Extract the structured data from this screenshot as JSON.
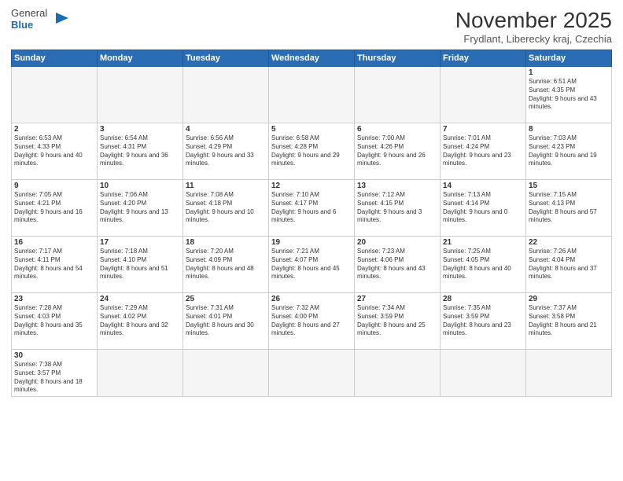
{
  "logo": {
    "general": "General",
    "blue": "Blue"
  },
  "title": {
    "month_year": "November 2025",
    "location": "Frydlant, Liberecky kraj, Czechia"
  },
  "weekdays": [
    "Sunday",
    "Monday",
    "Tuesday",
    "Wednesday",
    "Thursday",
    "Friday",
    "Saturday"
  ],
  "weeks": [
    [
      {
        "day": "",
        "info": ""
      },
      {
        "day": "",
        "info": ""
      },
      {
        "day": "",
        "info": ""
      },
      {
        "day": "",
        "info": ""
      },
      {
        "day": "",
        "info": ""
      },
      {
        "day": "",
        "info": ""
      },
      {
        "day": "1",
        "info": "Sunrise: 6:51 AM\nSunset: 4:35 PM\nDaylight: 9 hours and 43 minutes."
      }
    ],
    [
      {
        "day": "2",
        "info": "Sunrise: 6:53 AM\nSunset: 4:33 PM\nDaylight: 9 hours and 40 minutes."
      },
      {
        "day": "3",
        "info": "Sunrise: 6:54 AM\nSunset: 4:31 PM\nDaylight: 9 hours and 36 minutes."
      },
      {
        "day": "4",
        "info": "Sunrise: 6:56 AM\nSunset: 4:29 PM\nDaylight: 9 hours and 33 minutes."
      },
      {
        "day": "5",
        "info": "Sunrise: 6:58 AM\nSunset: 4:28 PM\nDaylight: 9 hours and 29 minutes."
      },
      {
        "day": "6",
        "info": "Sunrise: 7:00 AM\nSunset: 4:26 PM\nDaylight: 9 hours and 26 minutes."
      },
      {
        "day": "7",
        "info": "Sunrise: 7:01 AM\nSunset: 4:24 PM\nDaylight: 9 hours and 23 minutes."
      },
      {
        "day": "8",
        "info": "Sunrise: 7:03 AM\nSunset: 4:23 PM\nDaylight: 9 hours and 19 minutes."
      }
    ],
    [
      {
        "day": "9",
        "info": "Sunrise: 7:05 AM\nSunset: 4:21 PM\nDaylight: 9 hours and 16 minutes."
      },
      {
        "day": "10",
        "info": "Sunrise: 7:06 AM\nSunset: 4:20 PM\nDaylight: 9 hours and 13 minutes."
      },
      {
        "day": "11",
        "info": "Sunrise: 7:08 AM\nSunset: 4:18 PM\nDaylight: 9 hours and 10 minutes."
      },
      {
        "day": "12",
        "info": "Sunrise: 7:10 AM\nSunset: 4:17 PM\nDaylight: 9 hours and 6 minutes."
      },
      {
        "day": "13",
        "info": "Sunrise: 7:12 AM\nSunset: 4:15 PM\nDaylight: 9 hours and 3 minutes."
      },
      {
        "day": "14",
        "info": "Sunrise: 7:13 AM\nSunset: 4:14 PM\nDaylight: 9 hours and 0 minutes."
      },
      {
        "day": "15",
        "info": "Sunrise: 7:15 AM\nSunset: 4:13 PM\nDaylight: 8 hours and 57 minutes."
      }
    ],
    [
      {
        "day": "16",
        "info": "Sunrise: 7:17 AM\nSunset: 4:11 PM\nDaylight: 8 hours and 54 minutes."
      },
      {
        "day": "17",
        "info": "Sunrise: 7:18 AM\nSunset: 4:10 PM\nDaylight: 8 hours and 51 minutes."
      },
      {
        "day": "18",
        "info": "Sunrise: 7:20 AM\nSunset: 4:09 PM\nDaylight: 8 hours and 48 minutes."
      },
      {
        "day": "19",
        "info": "Sunrise: 7:21 AM\nSunset: 4:07 PM\nDaylight: 8 hours and 45 minutes."
      },
      {
        "day": "20",
        "info": "Sunrise: 7:23 AM\nSunset: 4:06 PM\nDaylight: 8 hours and 43 minutes."
      },
      {
        "day": "21",
        "info": "Sunrise: 7:25 AM\nSunset: 4:05 PM\nDaylight: 8 hours and 40 minutes."
      },
      {
        "day": "22",
        "info": "Sunrise: 7:26 AM\nSunset: 4:04 PM\nDaylight: 8 hours and 37 minutes."
      }
    ],
    [
      {
        "day": "23",
        "info": "Sunrise: 7:28 AM\nSunset: 4:03 PM\nDaylight: 8 hours and 35 minutes."
      },
      {
        "day": "24",
        "info": "Sunrise: 7:29 AM\nSunset: 4:02 PM\nDaylight: 8 hours and 32 minutes."
      },
      {
        "day": "25",
        "info": "Sunrise: 7:31 AM\nSunset: 4:01 PM\nDaylight: 8 hours and 30 minutes."
      },
      {
        "day": "26",
        "info": "Sunrise: 7:32 AM\nSunset: 4:00 PM\nDaylight: 8 hours and 27 minutes."
      },
      {
        "day": "27",
        "info": "Sunrise: 7:34 AM\nSunset: 3:59 PM\nDaylight: 8 hours and 25 minutes."
      },
      {
        "day": "28",
        "info": "Sunrise: 7:35 AM\nSunset: 3:59 PM\nDaylight: 8 hours and 23 minutes."
      },
      {
        "day": "29",
        "info": "Sunrise: 7:37 AM\nSunset: 3:58 PM\nDaylight: 8 hours and 21 minutes."
      }
    ],
    [
      {
        "day": "30",
        "info": "Sunrise: 7:38 AM\nSunset: 3:57 PM\nDaylight: 8 hours and 18 minutes."
      },
      {
        "day": "",
        "info": ""
      },
      {
        "day": "",
        "info": ""
      },
      {
        "day": "",
        "info": ""
      },
      {
        "day": "",
        "info": ""
      },
      {
        "day": "",
        "info": ""
      },
      {
        "day": "",
        "info": ""
      }
    ]
  ]
}
